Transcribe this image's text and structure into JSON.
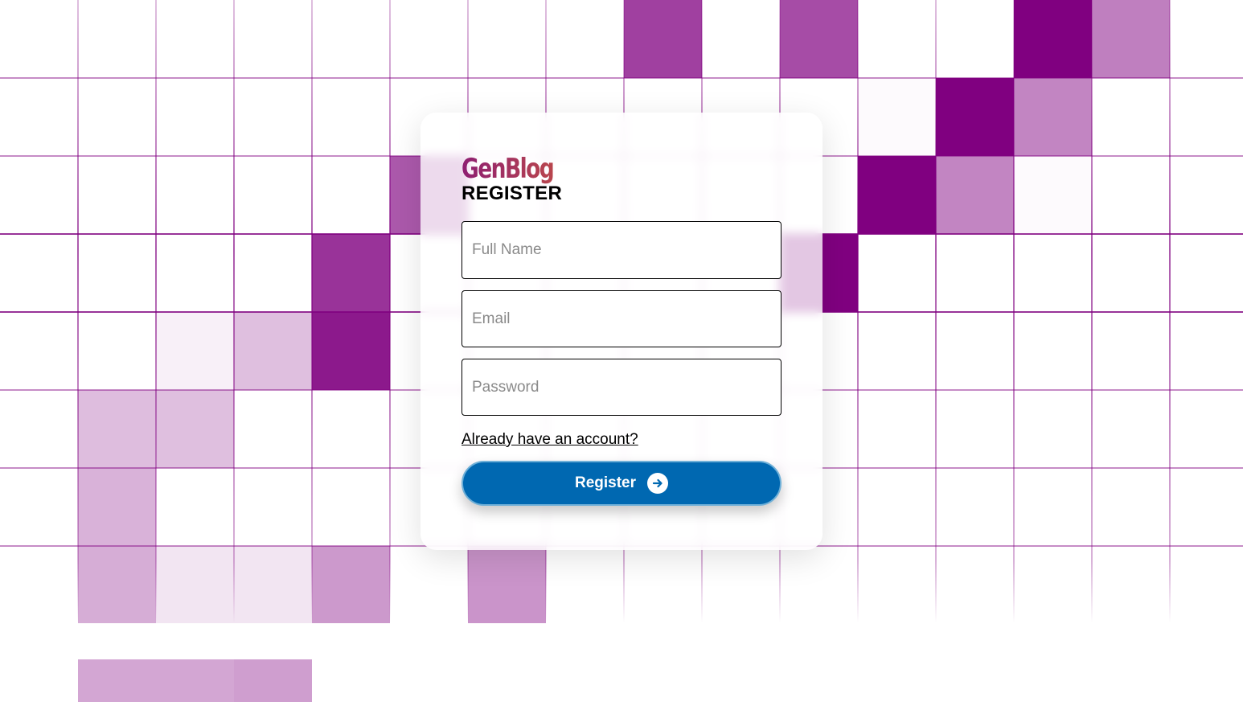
{
  "brand": {
    "logo_text": "GenBlog",
    "logo_colors": [
      "#8e1f72",
      "#c24e45",
      "#d4851c"
    ]
  },
  "form": {
    "heading": "REGISTER",
    "full_name_placeholder": "Full Name",
    "email_placeholder": "Email",
    "password_placeholder": "Password",
    "full_name_value": "",
    "email_value": "",
    "password_value": "",
    "login_link_label": "Already have an account?",
    "submit_label": "Register",
    "submit_icon": "arrow-right-circle-icon"
  },
  "colors": {
    "accent": "#0068b1",
    "background_tile": "#800080",
    "card": "#ffffff"
  }
}
